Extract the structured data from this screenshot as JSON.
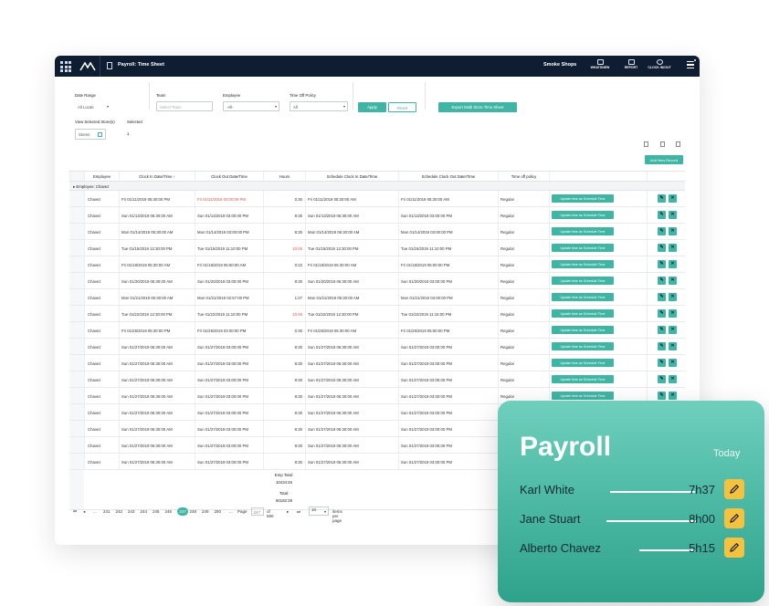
{
  "topbar": {
    "title": "Payroll: Time Sheet",
    "store": "Smoke Shops",
    "nav": [
      {
        "label": "WHATSNEW",
        "icon": "megaphone-icon"
      },
      {
        "label": "REPORT",
        "icon": "chart-icon"
      },
      {
        "label": "CLOCK IN/OUT",
        "icon": "clock-icon"
      }
    ]
  },
  "filters": {
    "date_range_label": "Date Range",
    "date_range_value": "All Locati",
    "team_label": "Team",
    "team_placeholder": "Select Team",
    "employee_label": "Employee",
    "employee_value": "-All-",
    "time_off_label": "Time Off Policy",
    "time_off_value": "All",
    "apply_label": "Apply",
    "reset_label": "Reset",
    "export_label": "Export Multi Store Time Sheet",
    "view_stores_label": "View Selected Store(s)",
    "selected_label": "Selected",
    "stores_button": "Stores",
    "selected_count": "1"
  },
  "table": {
    "add_label": "Add New Record",
    "columns": [
      "Employee",
      "Clock In Date/Time ↑",
      "Clock Out Date/Time",
      "Hours",
      "Schedule Clock In Date/Time",
      "Schedule Clock Out Date/Time",
      "Time off policy"
    ],
    "group_label": "▸ Employee: Chavez",
    "update_label": "Update time as Schedule Time",
    "rows": [
      {
        "emp": "Chavez",
        "in": "Fri 01/11/2019 05:30:00 PM",
        "out": "Fri 01/11/2019 03:00:00 PM",
        "out_red": true,
        "hours": "0:30",
        "sin": "Fri 01/11/2019 05:30:00 AM",
        "sout": "Fri 01/11/2019 05:30:00 AM",
        "pol": "Regular"
      },
      {
        "emp": "Chavez",
        "in": "Sun 01/13/2019 06:30:00 AM",
        "out": "Sun 01/13/2019 03:00:00 PM",
        "hours": "8:30",
        "sin": "Sun 01/13/2019 06:30:00 AM",
        "sout": "Sun 01/13/2019 03:00:00 PM",
        "pol": "Regular"
      },
      {
        "emp": "Chavez",
        "in": "Mon 01/14/2019 05:30:00 AM",
        "out": "Mon 01/14/2019 03:00:00 PM",
        "hours": "8:30",
        "sin": "Mon 01/14/2019 06:30:00 AM",
        "sout": "Mon 01/14/2019 03:00:00 PM",
        "pol": "Regular"
      },
      {
        "emp": "Chavez",
        "in": "Tue 01/15/2019 12:30:00 PM",
        "out": "Tue 01/15/2019 11:10:00 PM",
        "hours": "10:45",
        "hours_red": true,
        "sin": "Tue 01/15/2019 12:30:00 PM",
        "sout": "Tue 01/15/2019 11:10:00 PM",
        "pol": "Regular"
      },
      {
        "emp": "Chavez",
        "in": "Fri 01/18/2019 05:30:00 AM",
        "out": "Fri 01/18/2019 05:50:00 AM",
        "hours": "0:22",
        "sin": "Fri 01/18/2019 05:30:00 AM",
        "sout": "Fri 01/18/2019 05:00:00 PM",
        "pol": "Regular"
      },
      {
        "emp": "Chavez",
        "in": "Sun 01/20/2019 06:30:00 AM",
        "out": "Sun 01/20/2019 03:00:00 PM",
        "hours": "8:30",
        "sin": "Sun 01/20/2019 06:30:00 AM",
        "sout": "Sun 01/20/2019 03:00:00 PM",
        "pol": "Regular"
      },
      {
        "emp": "Chavez",
        "in": "Mon 01/21/2019 06:30:00 AM",
        "out": "Mon 01/21/2019 02:57:00 PM",
        "hours": "1:27",
        "sin": "Mon 01/21/2019 05:30:00 AM",
        "sout": "Mon 01/21/2019 03:00:00 PM",
        "pol": "Regular"
      },
      {
        "emp": "Chavez",
        "in": "Tue 01/22/2019 12:30:00 PM",
        "out": "Tue 01/22/2019 11:10:00 PM",
        "hours": "10:45",
        "hours_red": true,
        "sin": "Tue 01/22/2019 12:30:00 PM",
        "sout": "Tue 01/22/2019 11:15:00 PM",
        "pol": "Regular"
      },
      {
        "emp": "Chavez",
        "in": "Fri 01/25/2019 05:30:00 PM",
        "out": "Fri 01/25/2019 03:00:00 PM",
        "hours": "0:30",
        "sin": "Fri 01/25/2019 05:30:00 AM",
        "sout": "Fri 01/25/2019 05:00:00 PM",
        "pol": "Regular"
      },
      {
        "emp": "Chavez",
        "in": "Sun 01/27/2019 06:30:00 AM",
        "out": "Sun 01/27/2019 03:00:00 PM",
        "hours": "8:30",
        "sin": "Sun 01/27/2019 06:30:00 AM",
        "sout": "Sun 01/27/2019 03:00:00 PM",
        "pol": "Regular"
      },
      {
        "emp": "Chavez",
        "in": "Sun 01/27/2019 06:30:00 AM",
        "out": "Sun 01/27/2019 03:00:00 PM",
        "hours": "8:30",
        "sin": "Sun 01/27/2019 06:30:00 AM",
        "sout": "Sun 01/27/2019 03:00:00 PM",
        "pol": "Regular"
      },
      {
        "emp": "Chavez",
        "in": "Sun 01/27/2019 06:30:00 AM",
        "out": "Sun 01/27/2019 03:00:00 PM",
        "hours": "8:30",
        "sin": "Sun 01/27/2019 06:30:00 AM",
        "sout": "Sun 01/27/2019 03:00:00 PM",
        "pol": "Regular"
      },
      {
        "emp": "Chavez",
        "in": "Sun 01/27/2019 06:30:00 AM",
        "out": "Sun 01/27/2019 03:00:00 PM",
        "hours": "8:30",
        "sin": "Sun 01/27/2019 06:30:00 AM",
        "sout": "Sun 01/27/2019 03:00:00 PM",
        "pol": "Regular"
      },
      {
        "emp": "Chavez",
        "in": "Sun 01/27/2019 06:30:00 AM",
        "out": "Sun 01/27/2019 03:00:00 PM",
        "hours": "8:30",
        "sin": "Sun 01/27/2019 06:30:00 AM",
        "sout": "Sun 01/27/2019 03:00:00 PM",
        "pol": "Regular"
      },
      {
        "emp": "Chavez",
        "in": "Sun 01/27/2019 06:30:00 AM",
        "out": "Sun 01/27/2019 03:00:00 PM",
        "hours": "8:30",
        "sin": "Sun 01/27/2019 06:30:00 AM",
        "sout": "Sun 01/27/2019 03:00:00 PM",
        "pol": "Regular"
      },
      {
        "emp": "Chavez",
        "in": "Sun 01/27/2019 06:30:00 AM",
        "out": "Sun 01/27/2019 03:00:00 PM",
        "hours": "8:30",
        "sin": "Sun 01/27/2019 06:30:00 AM",
        "sout": "Sun 01/27/2019 03:00:00 PM",
        "pol": "Regular"
      },
      {
        "emp": "Chavez",
        "in": "Sun 01/27/2019 06:30:00 AM",
        "out": "Sun 01/27/2019 03:00:00 PM",
        "hours": "8:30",
        "sin": "Sun 01/27/2019 06:30:00 AM",
        "sout": "Sun 01/27/2019 03:00:00 PM",
        "pol": "Regular"
      }
    ],
    "emp_total_label": "Emp Total:",
    "emp_total_value": "10434:46",
    "total_label": "Total:",
    "total_value": "50182:39"
  },
  "pager": {
    "pages": [
      "241",
      "242",
      "243",
      "244",
      "245",
      "246",
      "247",
      "248",
      "249",
      "250"
    ],
    "current": "247",
    "page_label": "Page",
    "page_value": "247",
    "of_label": "of 590",
    "per_page_value": "10",
    "per_page_label": "items per page"
  },
  "card": {
    "title": "Payroll",
    "today": "Today",
    "entries": [
      {
        "name": "Karl White",
        "time": "7h37"
      },
      {
        "name": "Jane Stuart",
        "time": "8h00"
      },
      {
        "name": "Alberto Chavez",
        "time": "5h15"
      }
    ]
  },
  "colors": {
    "topbar": "#0f1d33",
    "accent": "#40b5a4",
    "card_top": "#6fcfbd",
    "card_bottom": "#2fa28c",
    "pencil_button": "#f5c23e"
  }
}
